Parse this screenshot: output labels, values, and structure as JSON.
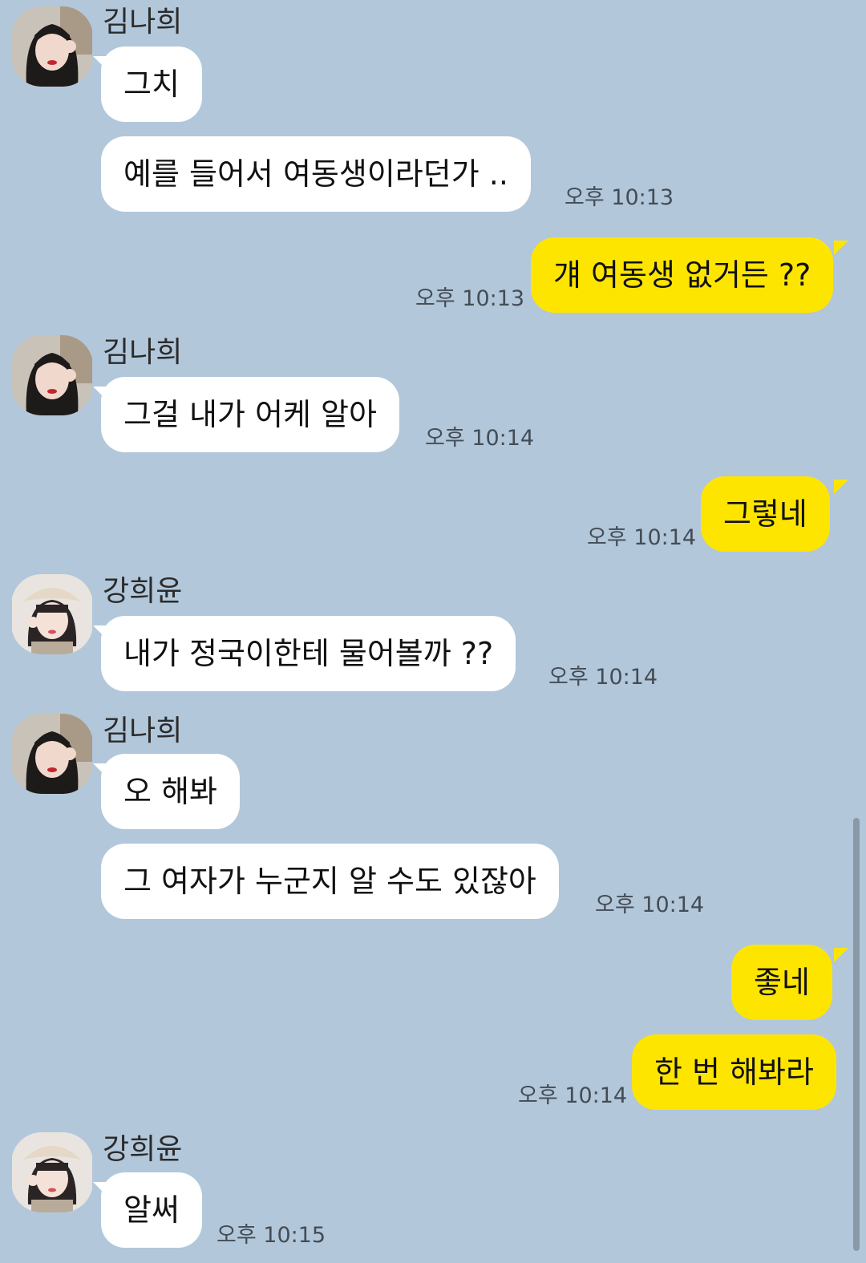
{
  "senders": {
    "nahee": "김나희",
    "heeyoon": "강희윤"
  },
  "messages": [
    {
      "id": "m1",
      "dir": "in",
      "text": "그치"
    },
    {
      "id": "m2",
      "dir": "in",
      "text": "예를 들어서 여동생이라던가 ..",
      "time": "오후 10:13"
    },
    {
      "id": "m3",
      "dir": "out",
      "text": "걔 여동생 없거든 ??",
      "time": "오후 10:13"
    },
    {
      "id": "m4",
      "dir": "in",
      "text": "그걸 내가 어케 알아",
      "time": "오후 10:14"
    },
    {
      "id": "m5",
      "dir": "out",
      "text": "그렇네",
      "time": "오후 10:14"
    },
    {
      "id": "m6",
      "dir": "in",
      "text": "내가 정국이한테 물어볼까 ??",
      "time": "오후 10:14"
    },
    {
      "id": "m7",
      "dir": "in",
      "text": "오 해봐"
    },
    {
      "id": "m8",
      "dir": "in",
      "text": "그 여자가 누군지 알 수도 있잖아",
      "time": "오후 10:14"
    },
    {
      "id": "m9",
      "dir": "out",
      "text": "좋네"
    },
    {
      "id": "m10",
      "dir": "out",
      "text": "한 번 해봐라",
      "time": "오후 10:14"
    },
    {
      "id": "m11",
      "dir": "in",
      "text": "알써",
      "time": "오후 10:15"
    }
  ],
  "colors": {
    "background": "#b2c7da",
    "incoming_bubble": "#ffffff",
    "outgoing_bubble": "#fee500"
  },
  "icons": {
    "nahee_avatar": "profile-photo-dark-hair",
    "heeyoon_avatar": "profile-photo-beret"
  }
}
